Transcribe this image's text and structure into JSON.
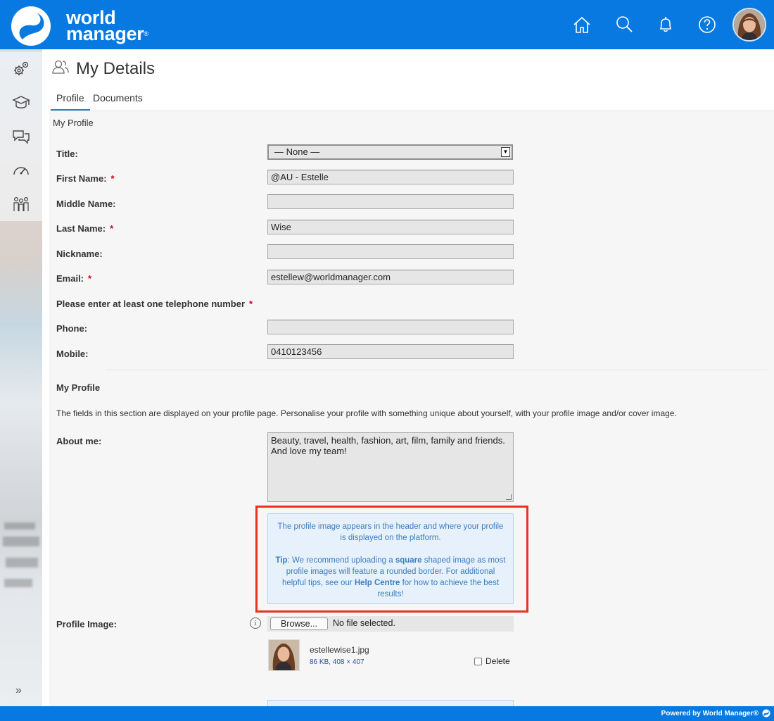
{
  "brand": {
    "line1": "world",
    "line2": "manager",
    "reg": "®"
  },
  "header_icons": [
    "home-icon",
    "search-icon",
    "bell-icon",
    "help-icon"
  ],
  "sidebar": {
    "items": [
      {
        "name": "settings-icon"
      },
      {
        "name": "learning-icon"
      },
      {
        "name": "chat-icon"
      },
      {
        "name": "dashboard-icon"
      },
      {
        "name": "people-icon"
      }
    ],
    "expand": "»"
  },
  "page": {
    "title": "My Details"
  },
  "tabs": [
    {
      "label": "Profile",
      "active": true
    },
    {
      "label": "Documents",
      "active": false
    }
  ],
  "section_title": "My Profile",
  "form": {
    "title": {
      "label": "Title:",
      "value": "— None —"
    },
    "first_name": {
      "label": "First Name:",
      "value": "@AU - Estelle"
    },
    "middle_name": {
      "label": "Middle Name:",
      "value": ""
    },
    "last_name": {
      "label": "Last Name:",
      "value": "Wise"
    },
    "nickname": {
      "label": "Nickname:",
      "value": ""
    },
    "email": {
      "label": "Email:",
      "value": "estellew@worldmanager.com"
    },
    "telephone_note": "Please enter at least one telephone number",
    "phone": {
      "label": "Phone:",
      "value": ""
    },
    "mobile": {
      "label": "Mobile:",
      "value": "0410123456"
    },
    "required_mark": "*"
  },
  "profile_section": {
    "title": "My Profile",
    "description": "The fields in this section are displayed on your profile page. Personalise your profile with something unique about yourself, with your profile image and/or cover image.",
    "about_label": "About me:",
    "about_value": "Beauty, travel, health, fashion, art, film, family and friends. And love my team!",
    "info": {
      "line1": "The profile image appears in the header and where your profile is displayed on the platform.",
      "tip_label": "Tip",
      "tip_a": ": We recommend uploading a ",
      "tip_bold": "square",
      "tip_b": " shaped image as most profile images will feature a rounded border. For additional helpful tips, see our ",
      "tip_link": "Help Centre",
      "tip_c": " for how to achieve the best results!"
    },
    "image_label": "Profile Image:",
    "browse_label": "Browse...",
    "no_file": "No file selected.",
    "file_name": "estellewise1.jpg",
    "file_meta": "86 KB, 408 × 407",
    "delete_label": "Delete"
  },
  "footer": {
    "text": "Powered by World Manager®"
  },
  "colors": {
    "brand_blue": "#0779e0",
    "required": "#d0021b",
    "highlight": "#e8321e",
    "info_text": "#3d7cc0"
  }
}
